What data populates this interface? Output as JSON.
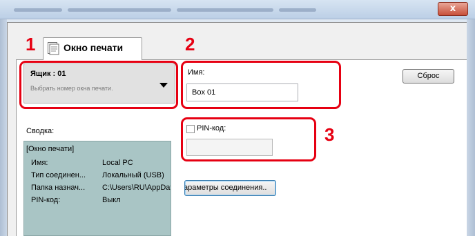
{
  "window": {
    "close_glyph": "x"
  },
  "tab": {
    "label": "Окно печати",
    "icon": "document-icon"
  },
  "mailbox": {
    "title": "Ящик : 01",
    "hint": "Выбрать номер окна печати."
  },
  "name": {
    "label": "Имя:",
    "value": "Box 01"
  },
  "reset_button": "Сброс",
  "pin": {
    "label": "PIN-код:",
    "checked": false,
    "value": ""
  },
  "summary": {
    "label": "Сводка:",
    "header": "[Окно печати]",
    "rows": [
      {
        "key": "Имя:",
        "value": "Local PC"
      },
      {
        "key": "Тип соединен...",
        "value": "Локальный (USB)"
      },
      {
        "key": "Папка назнач...",
        "value": "C:\\Users\\RU\\AppDat"
      },
      {
        "key": "PIN-код:",
        "value": "Выкл"
      }
    ]
  },
  "connection_button": "араметры соединения..",
  "callouts": [
    "1",
    "2",
    "3"
  ],
  "colors": {
    "callout": "#e60012",
    "summary_bg": "#a9c5c5"
  }
}
